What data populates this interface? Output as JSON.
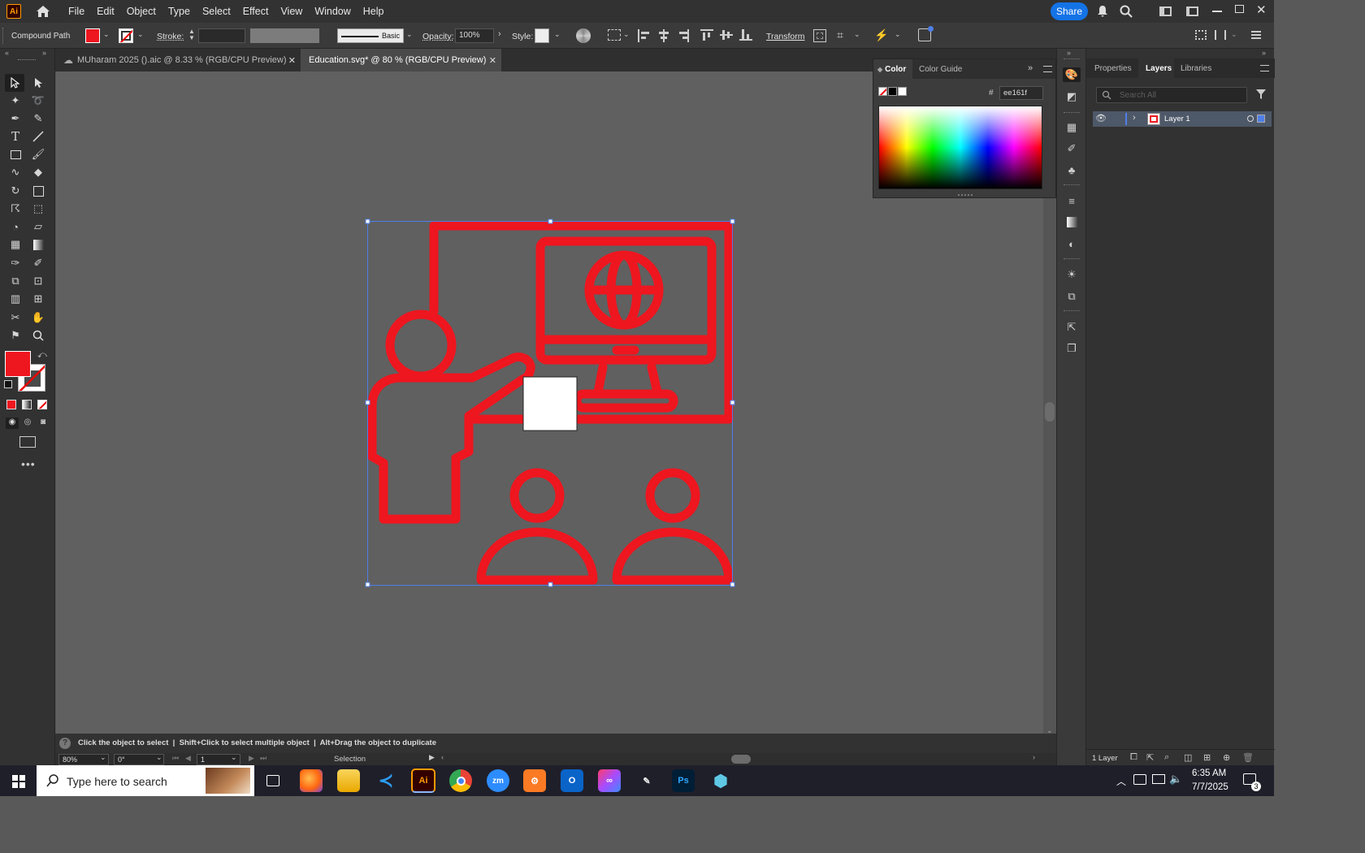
{
  "app": {
    "logo": "Ai"
  },
  "menu": [
    "File",
    "Edit",
    "Object",
    "Type",
    "Select",
    "Effect",
    "View",
    "Window",
    "Help"
  ],
  "header": {
    "share_label": "Share"
  },
  "control_bar": {
    "selection_type": "Compound Path",
    "stroke_label": "Stroke:",
    "brush_label": "Basic",
    "opacity_label": "Opacity:",
    "opacity_value": "100%",
    "style_label": "Style:",
    "transform_label": "Transform",
    "fill_color": "#ee161f"
  },
  "tabs": [
    {
      "label": "MUharam 2025 ().aic @ 8.33 % (RGB/CPU Preview)",
      "active": false
    },
    {
      "label": "Education.svg* @ 80 % (RGB/CPU Preview)",
      "active": true
    }
  ],
  "color_panel": {
    "tabs": [
      "Color",
      "Color Guide"
    ],
    "hex_label": "#",
    "hex_value": "ee161f"
  },
  "layers_panel": {
    "tabs": [
      "Properties",
      "Layers",
      "Libraries"
    ],
    "search_placeholder": "Search All",
    "layers": [
      {
        "name": "Layer 1"
      }
    ],
    "footer_count": "1 Layer"
  },
  "status": {
    "hint": "Click the object to select  |  Shift+Click to select multiple object  |  Alt+Drag the object to duplicate",
    "zoom": "80%",
    "rotation": "0°",
    "artboard": "1",
    "tool": "Selection"
  },
  "taskbar": {
    "search_placeholder": "Type here to search",
    "time": "6:35 AM",
    "date": "7/7/2025",
    "notification_count": "3"
  },
  "colors": {
    "accent": "#ee161f",
    "selection": "#4f7fe8",
    "share": "#1473e6"
  }
}
